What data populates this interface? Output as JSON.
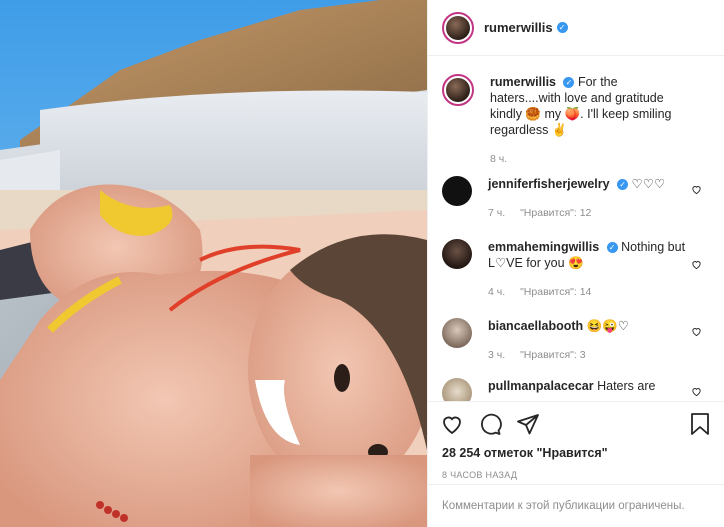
{
  "post": {
    "author": "rumerwillis",
    "verified_mark": "✓",
    "caption": "For the haters....with love and gratitude kindly 🥮 my 🍑. I'll keep smiling regardless ✌",
    "caption_time": "8 ч."
  },
  "comments": [
    {
      "user": "jenniferfisherjewelry",
      "text": "♡♡♡",
      "time": "7 ч.",
      "likes": "\"Нравится\": 12"
    },
    {
      "user": "emmahemingwillis",
      "text": "Nothing but L♡VE for you 😍",
      "time": "4 ч.",
      "likes": "\"Нравится\": 14"
    },
    {
      "user": "biancaellabooth",
      "text": "😆😜♡",
      "time": "3 ч.",
      "likes": "\"Нравится\": 3"
    },
    {
      "user": "pullmanpalacecar",
      "text": "Haters are",
      "time": "",
      "likes": ""
    }
  ],
  "actions": {
    "likes_count": "28 254 отметок \"Нравится\"",
    "posted_ago": "8 ЧАСОВ НАЗАД"
  },
  "footer": {
    "restricted": "Комментарии к этой публикации ограничены."
  },
  "colors": {
    "verified": "#3897f0",
    "muted": "#8e8e8e",
    "border": "#efefef"
  }
}
